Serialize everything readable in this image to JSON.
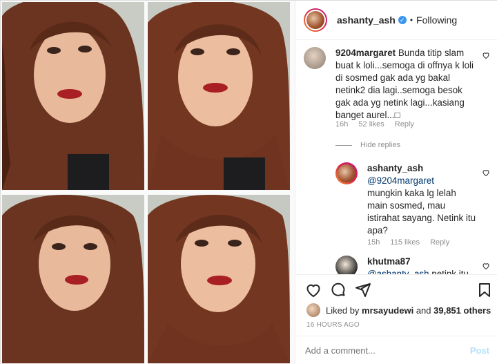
{
  "header": {
    "username": "ashanty_ash",
    "separator": "•",
    "follow_status": "Following"
  },
  "comments": [
    {
      "username": "9204margaret",
      "text": "Bunda titip slam buat k loli...semoga di offnya k loli di sosmed gak ada yg bakal netink2 dia lagi..semoga besok gak ada yg netink lagi...kasiang banget aurel...□",
      "time": "16h",
      "likes": "52 likes",
      "reply": "Reply"
    }
  ],
  "hide_replies": "Hide replies",
  "replies": [
    {
      "username": "ashanty_ash",
      "mention": "@9204margaret",
      "text": "mungkin kaka lg lelah main sosmed, mau istirahat sayang. Netink itu apa?",
      "time": "15h",
      "likes": "115 likes",
      "reply": "Reply"
    },
    {
      "username": "khutma87",
      "mention": "@ashanty_ash",
      "text": "netink itu"
    }
  ],
  "likes": {
    "prefix": "Liked by ",
    "user": "mrsayudewi",
    "suffix": " and ",
    "others": "39,851 others"
  },
  "timestamp": "16 HOURS AGO",
  "add_comment": {
    "placeholder": "Add a comment...",
    "post": "Post"
  },
  "icons": [
    "heart-icon",
    "comment-icon",
    "share-icon",
    "bookmark-icon",
    "verified-badge-icon"
  ],
  "colors": {
    "verified": "#3897f0",
    "mention": "#00376b",
    "post_disabled": "#b2dffc",
    "meta": "#8e8e8e"
  }
}
